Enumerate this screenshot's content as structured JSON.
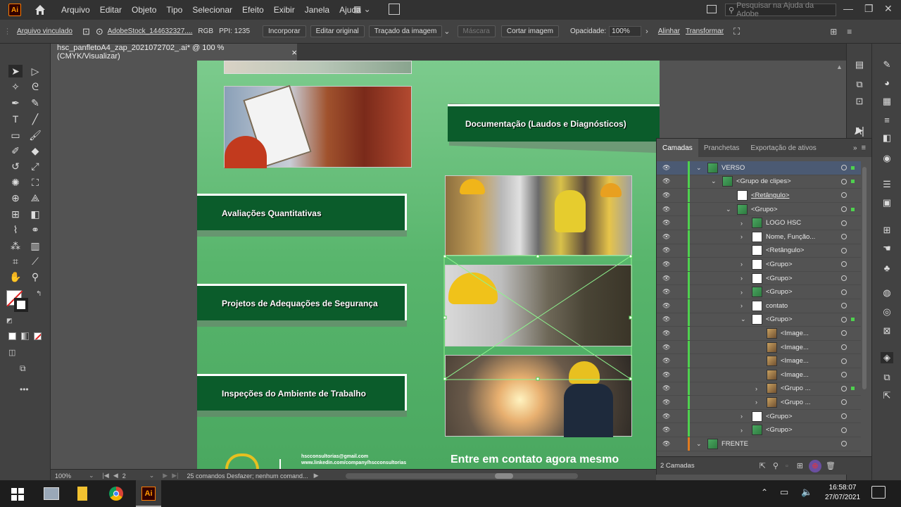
{
  "menubar": {
    "app_logo": "Ai",
    "items": [
      "Arquivo",
      "Editar",
      "Objeto",
      "Tipo",
      "Selecionar",
      "Efeito",
      "Exibir",
      "Janela",
      "Ajuda"
    ],
    "search_placeholder": "Pesquisar na Ajuda da Adobe"
  },
  "controlbar": {
    "linked_file": "Arquivo vinculado",
    "file_name": "AdobeStock_144632327....",
    "color_mode": "RGB",
    "ppi": "PPI: 1235",
    "embed": "Incorporar",
    "edit_original": "Editar original",
    "image_trace": "Traçado da imagem",
    "mask": "Máscara",
    "crop_image": "Cortar imagem",
    "opacity_label": "Opacidade:",
    "opacity_value": "100%",
    "align": "Alinhar",
    "transform": "Transformar"
  },
  "document_tab": {
    "title": "hsc_panfletoA4_zap_2021072702_.ai* @ 100 % (CMYK/Visualizar)",
    "close": "×"
  },
  "artboard": {
    "banners": [
      "Documentação (Laudos e Diagnósticos)",
      "Avaliações Quantitativas",
      "Projetos de Adequações de Segurança",
      "Inspeções do Ambiente de Trabalho"
    ],
    "cta": "Entre em contato agora mesmo",
    "contact_lines": [
      "hscconsultorias@gmail.com",
      "www.linkedin.com/company/hscconsultorias"
    ]
  },
  "layers_panel": {
    "tabs": [
      "Camadas",
      "Pranchetas",
      "Exportação de ativos"
    ],
    "rows": [
      {
        "name": "VERSO",
        "indent": 0,
        "expand": "open",
        "thumb": "pic",
        "selected": true,
        "underline": false,
        "selsq": true
      },
      {
        "name": "<Grupo de clipes>",
        "indent": 1,
        "expand": "open",
        "thumb": "pic",
        "selected": false,
        "underline": false,
        "selsq": true
      },
      {
        "name": "<Retângulo>",
        "indent": 2,
        "expand": "none",
        "thumb": "white",
        "selected": false,
        "underline": true,
        "selsq": false
      },
      {
        "name": "<Grupo>",
        "indent": 2,
        "expand": "open",
        "thumb": "pic",
        "selected": false,
        "underline": false,
        "selsq": true
      },
      {
        "name": "LOGO HSC",
        "indent": 3,
        "expand": "closed",
        "thumb": "pic",
        "selected": false,
        "underline": false,
        "selsq": false
      },
      {
        "name": "Nome, Função...",
        "indent": 3,
        "expand": "closed",
        "thumb": "white",
        "selected": false,
        "underline": false,
        "selsq": false
      },
      {
        "name": "<Retângulo>",
        "indent": 3,
        "expand": "none",
        "thumb": "white",
        "selected": false,
        "underline": false,
        "selsq": false
      },
      {
        "name": "<Grupo>",
        "indent": 3,
        "expand": "closed",
        "thumb": "white",
        "selected": false,
        "underline": false,
        "selsq": false
      },
      {
        "name": "<Grupo>",
        "indent": 3,
        "expand": "closed",
        "thumb": "white",
        "selected": false,
        "underline": false,
        "selsq": false
      },
      {
        "name": "<Grupo>",
        "indent": 3,
        "expand": "closed",
        "thumb": "pic",
        "selected": false,
        "underline": false,
        "selsq": false
      },
      {
        "name": "contato",
        "indent": 3,
        "expand": "closed",
        "thumb": "white",
        "selected": false,
        "underline": false,
        "selsq": false
      },
      {
        "name": "<Grupo>",
        "indent": 3,
        "expand": "open",
        "thumb": "white",
        "selected": false,
        "underline": false,
        "selsq": true
      },
      {
        "name": "<Image...",
        "indent": 4,
        "expand": "none",
        "thumb": "img",
        "selected": false,
        "underline": false,
        "selsq": false
      },
      {
        "name": "<Image...",
        "indent": 4,
        "expand": "none",
        "thumb": "img",
        "selected": false,
        "underline": false,
        "selsq": false
      },
      {
        "name": "<Image...",
        "indent": 4,
        "expand": "none",
        "thumb": "img",
        "selected": false,
        "underline": false,
        "selsq": false
      },
      {
        "name": "<Image...",
        "indent": 4,
        "expand": "none",
        "thumb": "img",
        "selected": false,
        "underline": false,
        "selsq": false
      },
      {
        "name": "<Grupo ...",
        "indent": 4,
        "expand": "closed",
        "thumb": "img",
        "selected": false,
        "underline": false,
        "selsq": true
      },
      {
        "name": "<Grupo ...",
        "indent": 4,
        "expand": "closed",
        "thumb": "img",
        "selected": false,
        "underline": false,
        "selsq": false
      },
      {
        "name": "<Grupo>",
        "indent": 3,
        "expand": "closed",
        "thumb": "white",
        "selected": false,
        "underline": false,
        "selsq": false
      },
      {
        "name": "<Grupo>",
        "indent": 3,
        "expand": "closed",
        "thumb": "pic",
        "selected": false,
        "underline": false,
        "selsq": false
      },
      {
        "name": "FRENTE",
        "indent": 0,
        "expand": "open",
        "thumb": "pic",
        "selected": false,
        "underline": false,
        "selsq": false
      }
    ],
    "footer_count": "2 Camadas"
  },
  "statusbar": {
    "zoom": "100%",
    "artboard_number": "2",
    "message": "25 comandos Desfazer; nenhum comand..."
  },
  "taskbar": {
    "time": "16:58:07",
    "date": "27/07/2021"
  },
  "colors": {
    "accent_green": "#0b5c2b",
    "layer_color_green": "#4ed14e",
    "layer_color_orange": "#e07b20",
    "selection_blue": "#4b5a73"
  }
}
